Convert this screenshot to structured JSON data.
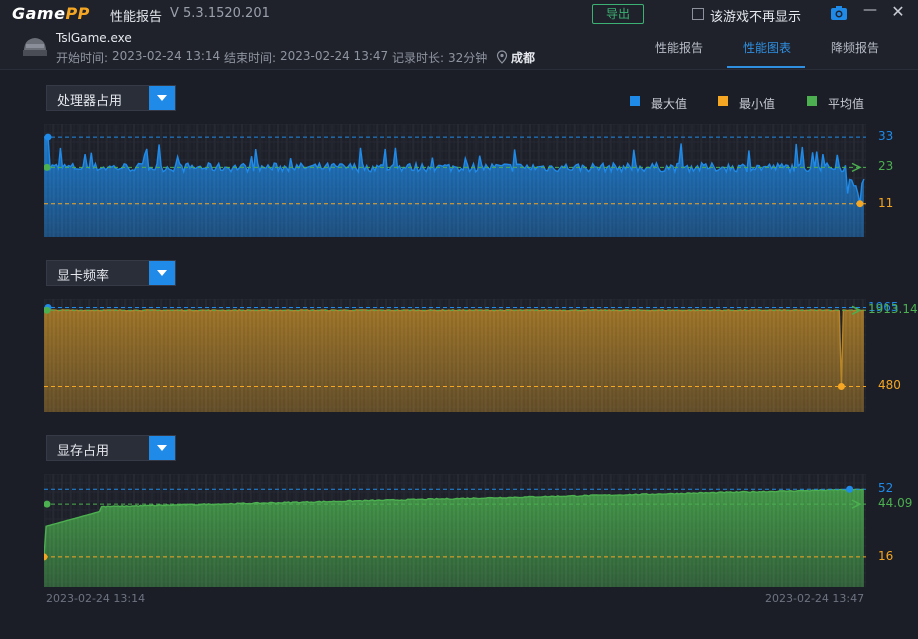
{
  "app": {
    "name_part1": "Game",
    "name_part2": "PP",
    "title": "性能报告",
    "version": "V 5.3.1520.201"
  },
  "titlebar": {
    "export_label": "导出",
    "hide_label": "该游戏不再显示"
  },
  "game": {
    "name": "TslGame.exe",
    "start_label": "开始时间:",
    "start_value": "2023-02-24 13:14",
    "end_label": "结束时间:",
    "end_value": "2023-02-24 13:47",
    "duration_label": "记录时长:",
    "duration_value": "32分钟",
    "city": "成都"
  },
  "tabs": [
    {
      "label": "性能报告",
      "active": false
    },
    {
      "label": "性能图表",
      "active": true
    },
    {
      "label": "降频报告",
      "active": false
    }
  ],
  "legend": [
    {
      "label": "最大值",
      "color": "#1f8ae8"
    },
    {
      "label": "最小值",
      "color": "#f5a623"
    },
    {
      "label": "平均值",
      "color": "#4caf50"
    }
  ],
  "chart_data": [
    {
      "type": "area",
      "title": "处理器占用",
      "series_color": "#1f8ae8",
      "max": 33,
      "min": 11,
      "avg": 23,
      "ylim": [
        0,
        36
      ]
    },
    {
      "type": "area",
      "title": "显卡频率",
      "series_color": "#b8862a",
      "max": 1965,
      "min": 480,
      "avg": 1913.14,
      "max_label": "1965",
      "min_label": "480",
      "avg_label": "1913.14",
      "ylim": [
        0,
        2050
      ]
    },
    {
      "type": "area",
      "title": "显存占用",
      "series_color": "#4caf50",
      "max": 52,
      "min": 16,
      "avg": 44.09,
      "ylim": [
        0,
        58
      ]
    }
  ],
  "dates": {
    "start": "2023-02-24 13:14",
    "end": "2023-02-24 13:47"
  }
}
